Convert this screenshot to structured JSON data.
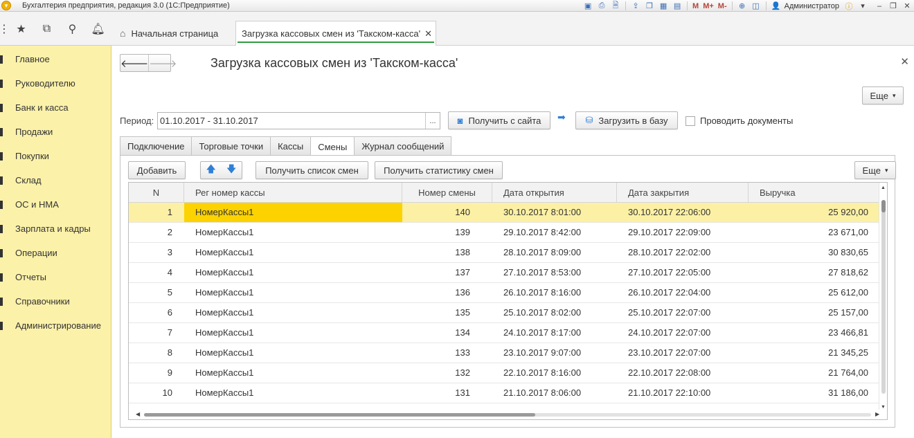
{
  "window": {
    "title": "Бухгалтерия предприятия, редакция 3.0  (1С:Предприятие)",
    "user": "Администратор",
    "toolbar_m_labels": [
      "M",
      "M+",
      "M-"
    ]
  },
  "tabs": {
    "home": "Начальная страница",
    "active": "Загрузка кассовых смен из 'Такском-касса'",
    "close_glyph": "✕"
  },
  "sidebar": {
    "items": [
      {
        "label": "Главное"
      },
      {
        "label": "Руководителю"
      },
      {
        "label": "Банк и касса"
      },
      {
        "label": "Продажи"
      },
      {
        "label": "Покупки"
      },
      {
        "label": "Склад"
      },
      {
        "label": "ОС и НМА"
      },
      {
        "label": "Зарплата и кадры"
      },
      {
        "label": "Операции"
      },
      {
        "label": "Отчеты"
      },
      {
        "label": "Справочники"
      },
      {
        "label": "Администрирование"
      }
    ]
  },
  "form": {
    "title": "Загрузка кассовых смен из 'Такском-касса'",
    "more_label": "Еще",
    "period_label": "Период:",
    "period_value": "01.10.2017 - 31.10.2017",
    "period_choose": "...",
    "get_from_site": "Получить с сайта",
    "load_to_db": "Загрузить в базу",
    "post_documents": "Проводить документы",
    "tabs": [
      "Подключение",
      "Торговые точки",
      "Кассы",
      "Смены",
      "Журнал сообщений"
    ],
    "active_tab": "Смены"
  },
  "grid_toolbar": {
    "add": "Добавить",
    "get_shift_list": "Получить список смен",
    "get_shift_stats": "Получить статистику смен",
    "more": "Еще"
  },
  "grid": {
    "columns": [
      "N",
      "Рег номер кассы",
      "Номер смены",
      "Дата открытия",
      "Дата закрытия",
      "Выручка"
    ],
    "rows": [
      {
        "n": "1",
        "reg": "НомерКассы1",
        "shift": "140",
        "open": "30.10.2017 8:01:00",
        "close": "30.10.2017 22:06:00",
        "revenue": "25 920,00"
      },
      {
        "n": "2",
        "reg": "НомерКассы1",
        "shift": "139",
        "open": "29.10.2017 8:42:00",
        "close": "29.10.2017 22:09:00",
        "revenue": "23 671,00"
      },
      {
        "n": "3",
        "reg": "НомерКассы1",
        "shift": "138",
        "open": "28.10.2017 8:09:00",
        "close": "28.10.2017 22:02:00",
        "revenue": "30 830,65"
      },
      {
        "n": "4",
        "reg": "НомерКассы1",
        "shift": "137",
        "open": "27.10.2017 8:53:00",
        "close": "27.10.2017 22:05:00",
        "revenue": "27 818,62"
      },
      {
        "n": "5",
        "reg": "НомерКассы1",
        "shift": "136",
        "open": "26.10.2017 8:16:00",
        "close": "26.10.2017 22:04:00",
        "revenue": "25 612,00"
      },
      {
        "n": "6",
        "reg": "НомерКассы1",
        "shift": "135",
        "open": "25.10.2017 8:02:00",
        "close": "25.10.2017 22:07:00",
        "revenue": "25 157,00"
      },
      {
        "n": "7",
        "reg": "НомерКассы1",
        "shift": "134",
        "open": "24.10.2017 8:17:00",
        "close": "24.10.2017 22:07:00",
        "revenue": "23 466,81"
      },
      {
        "n": "8",
        "reg": "НомерКассы1",
        "shift": "133",
        "open": "23.10.2017 9:07:00",
        "close": "23.10.2017 22:07:00",
        "revenue": "21 345,25"
      },
      {
        "n": "9",
        "reg": "НомерКассы1",
        "shift": "132",
        "open": "22.10.2017 8:16:00",
        "close": "22.10.2017 22:08:00",
        "revenue": "21 764,00"
      },
      {
        "n": "10",
        "reg": "НомерКассы1",
        "shift": "131",
        "open": "21.10.2017 8:06:00",
        "close": "21.10.2017 22:10:00",
        "revenue": "31 186,00"
      }
    ]
  },
  "colors": {
    "sidebar_bg": "#fbf1a9",
    "selected_row": "#fcf0a4",
    "current_cell": "#fcd200",
    "active_tab_underline": "#2f9a3f"
  }
}
